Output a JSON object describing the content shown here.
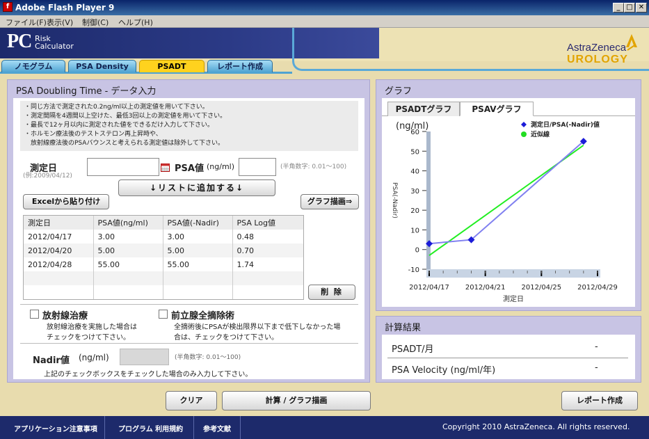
{
  "window": {
    "title": "Adobe Flash Player 9",
    "flash_icon": "f"
  },
  "window_buttons": {
    "minimize": "_",
    "maximize": "□",
    "close": "✕"
  },
  "menu": [
    "ファイル(F)",
    "表示(V)",
    "制御(C)",
    "ヘルプ(H)"
  ],
  "header": {
    "logo_main": "PC",
    "logo_sub1": "Risk",
    "logo_sub2": "Calculator",
    "brand": "AstraZeneca",
    "brand_sub": "UROLOGY"
  },
  "tabs": [
    {
      "label": "ノモグラム",
      "active": false
    },
    {
      "label": "PSA Density",
      "active": false
    },
    {
      "label": "PSADT",
      "active": true
    },
    {
      "label": "レポート作成",
      "active": false
    }
  ],
  "input_panel": {
    "title": "PSA Doubling Time - データ入力",
    "notes": [
      "・同じ方法で測定された0.2ng/ml以上の測定値を用いて下さい。",
      "・測定間隔を4週間以上空けた、最低3回以上の測定値を用いて下さい。",
      "・最長で12ヶ月以内に測定された値をできるだけ入力して下さい。",
      "・ホルモン療法後のテストステロン再上昇時や、",
      "　放射線療法後のPSAバウンスと考えられる測定値は除外して下さい。"
    ],
    "date_label": "測定日",
    "date_example": "(例:2009/04/12)",
    "date_value": "",
    "psa_label": "PSA値",
    "psa_unit": "(ng/ml)",
    "psa_value": "",
    "psa_hint": "(半角数字: 0.01〜100)",
    "add_button": "↓リストに追加する↓",
    "excel_button": "Excelから貼り付け",
    "graph_button": "グラフ描画⇒",
    "delete_button": "削 除",
    "table": {
      "headers": [
        "測定日",
        "PSA値(ng/ml)",
        "PSA値(-Nadir)",
        "PSA Log値"
      ],
      "rows": [
        [
          "2012/04/17",
          "3.00",
          "3.00",
          "0.48"
        ],
        [
          "2012/04/20",
          "5.00",
          "5.00",
          "0.70"
        ],
        [
          "2012/04/28",
          "55.00",
          "55.00",
          "1.74"
        ]
      ]
    },
    "radiation": {
      "label": "放射線治療",
      "desc1": "放射線治療を実施した場合は",
      "desc2": "チェックをつけて下さい。",
      "checked": false
    },
    "prostatectomy": {
      "label": "前立腺全摘除術",
      "desc1": "全摘術後にPSAが検出限界以下まで低下しなかった場",
      "desc2": "合は、チェックをつけて下さい。",
      "checked": false
    },
    "nadir": {
      "label": "Nadir値",
      "unit": "(ng/ml)",
      "value": "",
      "hint": "(半角数字: 0.01〜100)",
      "desc": "上記のチェックボックスをチェックした場合のみ入力して下さい。"
    }
  },
  "graph_panel": {
    "title": "グラフ",
    "tabs": [
      {
        "label": "PSADTグラフ",
        "active": false
      },
      {
        "label": "PSAVグラフ",
        "active": true
      }
    ],
    "unit_label": "(ng/ml)",
    "legend": [
      {
        "label": "測定日/PSA(-Nadir)値",
        "color": "#1c1cd8",
        "marker": "diamond"
      },
      {
        "label": "近似線",
        "color": "#22dd22",
        "marker": "circle"
      }
    ]
  },
  "chart_data": {
    "type": "line",
    "ylabel": "PSA(-Nadir)",
    "xlabel": "測定日",
    "ylim": [
      -10,
      60
    ],
    "yticks": [
      -10,
      0,
      10,
      20,
      30,
      40,
      50,
      60
    ],
    "xticks": [
      "2012/04/17",
      "2012/04/21",
      "2012/04/25",
      "2012/04/29"
    ],
    "series": [
      {
        "name": "測定日/PSA(-Nadir)値",
        "color": "#8080f0",
        "x": [
          "2012/04/17",
          "2012/04/20",
          "2012/04/28"
        ],
        "values": [
          3.0,
          5.0,
          55.0
        ]
      },
      {
        "name": "近似線",
        "color": "#22ee22",
        "x": [
          "2012/04/17",
          "2012/04/28"
        ],
        "values": [
          -3,
          53
        ]
      }
    ],
    "grid": false
  },
  "results_panel": {
    "title": "計算結果",
    "rows": [
      {
        "label": "PSADT/月",
        "value": "-"
      },
      {
        "label": "PSA Velocity (ng/ml/年)",
        "value": "-"
      }
    ]
  },
  "bottom_buttons": {
    "clear": "クリア",
    "calc": "計算 / グラフ描画",
    "report": "レポート作成"
  },
  "footer": {
    "links": [
      "アプリケーション注意事項",
      "プログラム 利用規約",
      "参考文献"
    ],
    "copyright": "Copyright 2010 AstraZeneca. All rights reserved."
  }
}
